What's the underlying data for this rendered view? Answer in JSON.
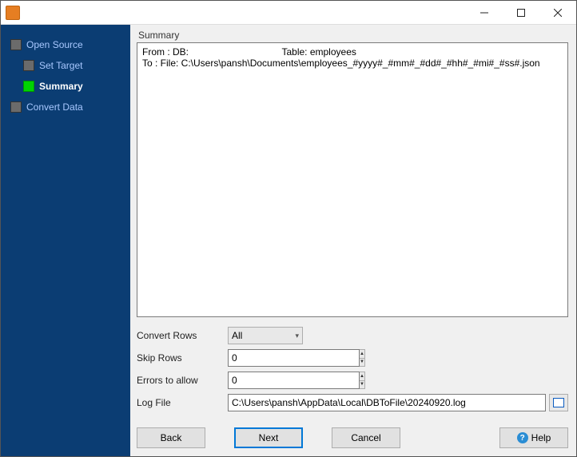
{
  "titlebar": {
    "title": ""
  },
  "sidebar": {
    "items": [
      {
        "label": "Open Source",
        "active": false,
        "sub": false
      },
      {
        "label": "Set Target",
        "active": false,
        "sub": true
      },
      {
        "label": "Summary",
        "active": true,
        "sub": true
      },
      {
        "label": "Convert Data",
        "active": false,
        "sub": false
      }
    ]
  },
  "summary": {
    "title": "Summary",
    "text": "From : DB:                                   Table: employees\nTo : File: C:\\Users\\pansh\\Documents\\employees_#yyyy#_#mm#_#dd#_#hh#_#mi#_#ss#.json"
  },
  "form": {
    "convert_rows": {
      "label": "Convert Rows",
      "value": "All"
    },
    "skip_rows": {
      "label": "Skip Rows",
      "value": "0"
    },
    "errors_allow": {
      "label": "Errors to allow",
      "value": "0"
    },
    "log_file": {
      "label": "Log File",
      "value": "C:\\Users\\pansh\\AppData\\Local\\DBToFile\\20240920.log"
    }
  },
  "buttons": {
    "back": "Back",
    "next": "Next",
    "cancel": "Cancel",
    "help": "Help"
  }
}
